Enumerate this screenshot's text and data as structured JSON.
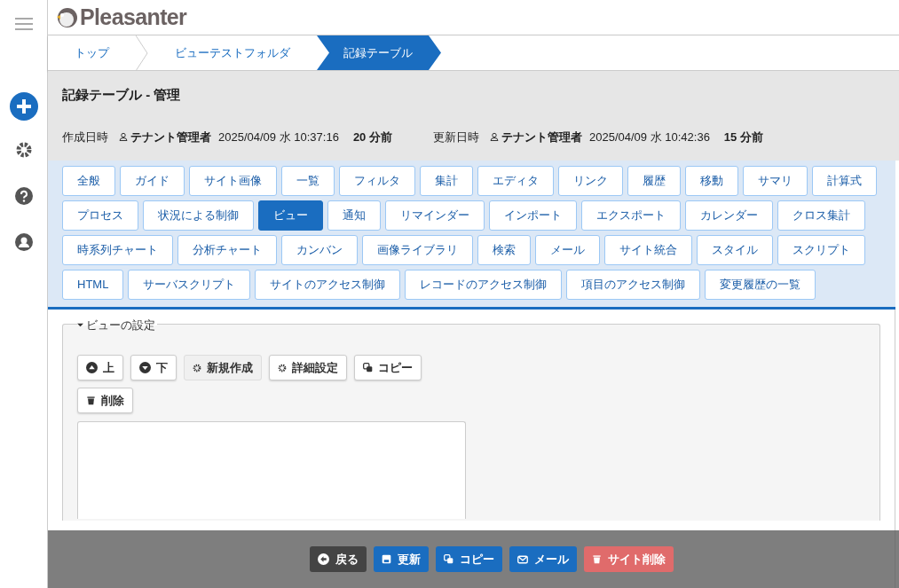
{
  "logo": {
    "text": "Pleasanter"
  },
  "breadcrumb": [
    {
      "label": "トップ",
      "selected": false
    },
    {
      "label": "ビューテストフォルダ",
      "selected": false
    },
    {
      "label": "記録テーブル",
      "selected": true
    }
  ],
  "page_title": "記録テーブル - 管理",
  "meta": [
    {
      "label": "作成日時",
      "user": "テナント管理者",
      "datetime": "2025/04/09 水 10:37:16",
      "elapsed": "20 分前"
    },
    {
      "label": "更新日時",
      "user": "テナント管理者",
      "datetime": "2025/04/09 水 10:42:36",
      "elapsed": "15 分前"
    }
  ],
  "tab_rows": [
    [
      {
        "label": "全般",
        "selected": false
      },
      {
        "label": "ガイド",
        "selected": false
      },
      {
        "label": "サイト画像",
        "selected": false
      },
      {
        "label": "一覧",
        "selected": false
      },
      {
        "label": "フィルタ",
        "selected": false
      },
      {
        "label": "集計",
        "selected": false
      },
      {
        "label": "エディタ",
        "selected": false
      },
      {
        "label": "リンク",
        "selected": false
      },
      {
        "label": "履歴",
        "selected": false
      },
      {
        "label": "移動",
        "selected": false
      },
      {
        "label": "サマリ",
        "selected": false
      },
      {
        "label": "計算式",
        "selected": false
      }
    ],
    [
      {
        "label": "プロセス",
        "selected": false
      },
      {
        "label": "状況による制御",
        "selected": false
      },
      {
        "label": "ビュー",
        "selected": true
      },
      {
        "label": "通知",
        "selected": false
      },
      {
        "label": "リマインダー",
        "selected": false
      },
      {
        "label": "インポート",
        "selected": false
      },
      {
        "label": "エクスポート",
        "selected": false
      },
      {
        "label": "カレンダー",
        "selected": false
      },
      {
        "label": "クロス集計",
        "selected": false
      }
    ],
    [
      {
        "label": "時系列チャート",
        "selected": false
      },
      {
        "label": "分析チャート",
        "selected": false
      },
      {
        "label": "カンバン",
        "selected": false
      },
      {
        "label": "画像ライブラリ",
        "selected": false
      },
      {
        "label": "検索",
        "selected": false
      },
      {
        "label": "メール",
        "selected": false
      },
      {
        "label": "サイト統合",
        "selected": false
      },
      {
        "label": "スタイル",
        "selected": false
      },
      {
        "label": "スクリプト",
        "selected": false
      }
    ],
    [
      {
        "label": "HTML",
        "selected": false
      },
      {
        "label": "サーバスクリプト",
        "selected": false
      },
      {
        "label": "サイトのアクセス制御",
        "selected": false
      },
      {
        "label": "レコードのアクセス制御",
        "selected": false
      },
      {
        "label": "項目のアクセス制御",
        "selected": false
      },
      {
        "label": "変更履歴の一覧",
        "selected": false
      }
    ]
  ],
  "view_settings": {
    "legend": "ビューの設定",
    "expanded": true,
    "button_rows": [
      [
        {
          "label": "上",
          "disabled": false
        },
        {
          "label": "下",
          "disabled": false
        },
        {
          "label": "新規作成",
          "disabled": true
        },
        {
          "label": "詳細設定",
          "disabled": false
        },
        {
          "label": "コピー",
          "disabled": false
        }
      ],
      [
        {
          "label": "削除",
          "disabled": false
        }
      ]
    ]
  },
  "footer_buttons": [
    {
      "label": "戻る",
      "kind": "back"
    },
    {
      "label": "更新",
      "kind": "primary"
    },
    {
      "label": "コピー",
      "kind": "primary"
    },
    {
      "label": "メール",
      "kind": "primary"
    },
    {
      "label": "サイト削除",
      "kind": "danger"
    }
  ]
}
